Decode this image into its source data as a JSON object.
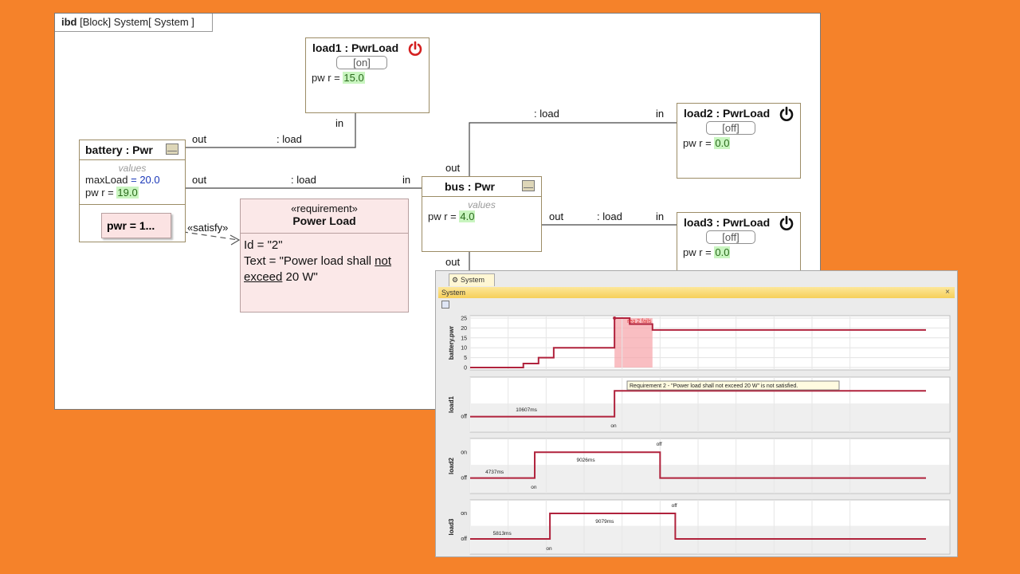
{
  "diagram": {
    "header_kind": "ibd",
    "header_text": "[Block] System[  System ]",
    "blocks": {
      "load1": {
        "title": "load1 : PwrLoad",
        "state": "[on]",
        "prop": "pw r",
        "eq": " = ",
        "value": "15.0"
      },
      "load2": {
        "title": "load2 : PwrLoad",
        "state": "[off]",
        "prop": "pw r",
        "eq": " = ",
        "value": "0.0"
      },
      "load3": {
        "title": "load3 : PwrLoad",
        "state": "[off]",
        "prop": "pw r",
        "eq": " = ",
        "value": "0.0"
      },
      "battery": {
        "title": "battery : Pwr",
        "values_label": "values",
        "maxload_prop": "maxLoad",
        "maxload_eq": " = ",
        "maxload_value": "20.0",
        "pwr_prop": "pw r",
        "pwr_eq": " = ",
        "pwr_value": "19.0"
      },
      "bus": {
        "title": "bus : Pwr",
        "values_label": "values",
        "prop": "pw r",
        "eq": " = ",
        "value": "4.0"
      }
    },
    "pwr_note": {
      "prop": "pwr",
      "eq": " = ",
      "value": "1..."
    },
    "requirement": {
      "stereotype": "«requirement»",
      "name": "Power Load",
      "id_line": "Id = \"2\"",
      "text_a": "Text = \"Power load shall ",
      "text_not": "not",
      "text_exceed": "exceed",
      "text_b": " 20 W\""
    },
    "satisfy_label": "«satisfy»",
    "port_labels": {
      "out": "out",
      "in": "in",
      "load": ": load"
    },
    "colors": {
      "power_on": "#d42020",
      "power_off": "#111111",
      "green_value": "#c9f5c0"
    }
  },
  "simulation": {
    "tab_label": "System",
    "window_title": "System",
    "close": "×",
    "alert_text": "req 2 fails",
    "tooltip": "Requirement 2 - \"Power load shall not exceed 20 W\" is not satisfied.",
    "colors": {
      "line": "#b0223c",
      "fail_band": "#f7a3a8"
    }
  },
  "chart_data": [
    {
      "type": "line",
      "ylabel": "battery.pwr",
      "ylim": [
        0,
        25
      ],
      "yticks": [
        0,
        5,
        10,
        15,
        20,
        25
      ],
      "x": [
        0,
        14,
        14,
        18,
        18,
        22,
        22,
        38,
        38,
        42,
        42,
        48,
        48,
        120
      ],
      "series": [
        {
          "values": [
            0,
            0,
            2,
            2,
            5,
            5,
            10,
            10,
            25,
            25,
            22,
            22,
            19,
            19
          ]
        }
      ],
      "grid": true
    },
    {
      "type": "line",
      "ylabel": "load1",
      "yticks": [
        "off"
      ],
      "states": [
        "off",
        "on"
      ],
      "x": [
        0,
        38,
        38,
        120
      ],
      "series": [
        {
          "values": [
            0,
            0,
            1,
            1
          ]
        }
      ],
      "annotations": [
        "10607ms",
        "on"
      ],
      "grid": true
    },
    {
      "type": "line",
      "ylabel": "load2",
      "yticks": [
        "on",
        "off"
      ],
      "states": [
        "off",
        "on"
      ],
      "x": [
        0,
        17,
        17,
        50,
        50,
        120
      ],
      "series": [
        {
          "values": [
            0,
            0,
            1,
            1,
            0,
            0
          ]
        }
      ],
      "annotations": [
        "4737ms",
        "on",
        "9026ms",
        "off"
      ],
      "grid": true
    },
    {
      "type": "line",
      "ylabel": "load3",
      "yticks": [
        "on",
        "off"
      ],
      "states": [
        "off",
        "on"
      ],
      "x": [
        0,
        21,
        21,
        54,
        54,
        120
      ],
      "series": [
        {
          "values": [
            0,
            0,
            1,
            1,
            0,
            0
          ]
        }
      ],
      "annotations": [
        "5813ms",
        "on",
        "9079ms",
        "off"
      ],
      "grid": true
    }
  ]
}
